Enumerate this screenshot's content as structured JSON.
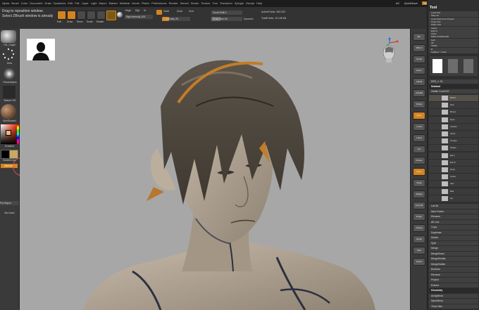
{
  "menu": [
    "Alpha",
    "Brush",
    "Color",
    "Document",
    "Draw",
    "Dynamics",
    "Edit",
    "File",
    "Layer",
    "Light",
    "Macro",
    "Marker",
    "Material",
    "Movie",
    "Picker",
    "Preferences",
    "Render",
    "Stencil",
    "Stroke",
    "Texture",
    "Tool",
    "Transform",
    "Zplugin",
    "Zscript",
    "Help"
  ],
  "menubar_right": {
    "ac": "AC",
    "quicksave": "QuickSave",
    "seethrough": "See-through 0",
    "menus": "Menus",
    "default_script": "DefaultZScript"
  },
  "notes": {
    "line1": "Drag to reposition window.",
    "line2": "Select ZBrush window is already"
  },
  "shelf": {
    "edit": "Edit",
    "draw": "Draw",
    "move": "Move",
    "scale": "Scale",
    "rotate": "Rotate",
    "mrgb": "Mrgb",
    "rgb": "Rgb",
    "m": "M",
    "rgb_intensity": "Rgb Intensity 100",
    "zadd": "Zadd",
    "zsub": "Zsub",
    "zcut": "Zcut",
    "z_intensity": "Z Intensity 25",
    "focal_shift": "Focal Shift 0",
    "draw_size": "Draw Size 64",
    "dynamic": "Dynamic",
    "active_points": "ActivePoints: 360,000",
    "total_points": "TotalPoints: 19.198 Mil"
  },
  "left": {
    "brush": "DR_ClayB",
    "stroke": "Dots",
    "alpha": "~BrushAlpha",
    "texture": "Texture Off",
    "material": "SkinShade4",
    "gradient": "Gradient",
    "switch": "SwitchColor",
    "alternate": "Alternate",
    "subtool_btn": "Subtool 0",
    "tool_btn": "Fill Object",
    "last": "Bcl Used"
  },
  "rstrip": [
    "Bpr",
    "SPix 3",
    "Scroll",
    "Zoom",
    "Actual",
    "AAHalf",
    "Persp",
    "Floor",
    "Local",
    "L.Sym",
    "Xyz",
    "Frame",
    "Move",
    "Scale",
    "Rotate",
    "Line Fill",
    "PolyF",
    "Transp",
    "Ghost",
    "Solo",
    "Xpose"
  ],
  "tool": {
    "title": "Tool",
    "top_items": [
      "Load Tool",
      "Save As",
      "Load Tools From Project",
      "Copy Tool",
      "Paste Tool",
      "Import",
      "Export",
      "Clone",
      "Make PolyMesh3D",
      "GoZ",
      "All",
      "Visible",
      "R",
      "Lightbox > Tools"
    ],
    "count": "DR3_1: 51",
    "subtool": "Subtool",
    "visible_count": "Visible Count 32",
    "subtool_names": [
      "BODY",
      "Hair",
      "Brows",
      "Eyes",
      "Lashes",
      "Teeth",
      "Tongue",
      "Straps",
      "Ear L",
      "Ear R",
      "Neck",
      "Chest",
      "Jaw",
      "Belt",
      "Lip"
    ],
    "actions": [
      "List All",
      "New Folder",
      "Rename",
      "All Low",
      "Copy",
      "Duplicate",
      "Delete",
      "Split",
      "Merge",
      "MergeDown",
      "MergeSimilar",
      "MergeVisible",
      "Boolean",
      "Remesh",
      "Project",
      "Extract",
      "Geometry",
      "ArrayMesh",
      "NanoMesh",
      "Thick Skin"
    ]
  }
}
